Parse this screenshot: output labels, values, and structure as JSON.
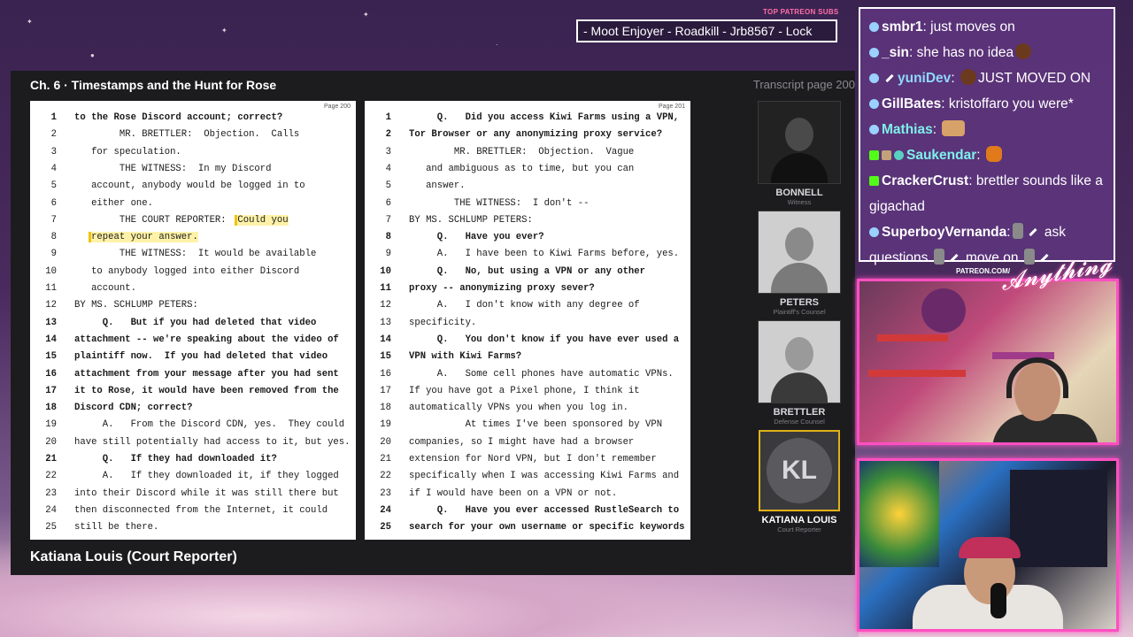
{
  "ticker": {
    "label": "TOP PATREON SUBS",
    "text": "- Moot Enjoyer - Roadkill - Jrb8567 - Lock"
  },
  "viewer": {
    "chapter": "Ch. 6  ·  Timestamps and the Hunt for Rose",
    "transcript_page": "Transcript page 200",
    "footer_speaker": "Katiana Louis (Court Reporter)",
    "pages": [
      {
        "page_label": "Page 200",
        "lines": [
          {
            "n": "1",
            "text": "to the Rose Discord account; correct?",
            "bold": true
          },
          {
            "n": "2",
            "text": "        MR. BRETTLER:  Objection.  Calls",
            "bold": false
          },
          {
            "n": "3",
            "text": "   for speculation.",
            "bold": false
          },
          {
            "n": "4",
            "text": "        THE WITNESS:  In my Discord",
            "bold": false
          },
          {
            "n": "5",
            "text": "   account, anybody would be logged in to",
            "bold": false
          },
          {
            "n": "6",
            "text": "   either one.",
            "bold": false
          },
          {
            "n": "7",
            "text": "        THE COURT REPORTER:  Could you",
            "bold": false
          },
          {
            "n": "8",
            "text": "   repeat your answer.",
            "bold": false
          },
          {
            "n": "9",
            "text": "        THE WITNESS:  It would be available",
            "bold": false
          },
          {
            "n": "10",
            "text": "   to anybody logged into either Discord",
            "bold": false
          },
          {
            "n": "11",
            "text": "   account.",
            "bold": false
          },
          {
            "n": "12",
            "text": "BY MS. SCHLUMP PETERS:",
            "bold": false
          },
          {
            "n": "13",
            "text": "     Q.   But if you had deleted that video",
            "bold": true
          },
          {
            "n": "14",
            "text": "attachment -- we're speaking about the video of",
            "bold": true
          },
          {
            "n": "15",
            "text": "plaintiff now.  If you had deleted that video",
            "bold": true
          },
          {
            "n": "16",
            "text": "attachment from your message after you had sent",
            "bold": true
          },
          {
            "n": "17",
            "text": "it to Rose, it would have been removed from the",
            "bold": true
          },
          {
            "n": "18",
            "text": "Discord CDN; correct?",
            "bold": true
          },
          {
            "n": "19",
            "text": "     A.   From the Discord CDN, yes.  They could",
            "bold": false
          },
          {
            "n": "20",
            "text": "have still potentially had access to it, but yes.",
            "bold": false
          },
          {
            "n": "21",
            "text": "     Q.   If they had downloaded it?",
            "bold": true
          },
          {
            "n": "22",
            "text": "     A.   If they downloaded it, if they logged",
            "bold": false
          },
          {
            "n": "23",
            "text": "into their Discord while it was still there but",
            "bold": false
          },
          {
            "n": "24",
            "text": "then disconnected from the Internet, it could",
            "bold": false
          },
          {
            "n": "25",
            "text": "still be there.",
            "bold": false
          }
        ],
        "highlight": [
          "Could you",
          "repeat your answer."
        ]
      },
      {
        "page_label": "Page 201",
        "lines": [
          {
            "n": "1",
            "text": "     Q.   Did you access Kiwi Farms using a VPN,",
            "bold": true
          },
          {
            "n": "2",
            "text": "Tor Browser or any anonymizing proxy service?",
            "bold": true
          },
          {
            "n": "3",
            "text": "        MR. BRETTLER:  Objection.  Vague",
            "bold": false
          },
          {
            "n": "4",
            "text": "   and ambiguous as to time, but you can",
            "bold": false
          },
          {
            "n": "5",
            "text": "   answer.",
            "bold": false
          },
          {
            "n": "6",
            "text": "        THE WITNESS:  I don't --",
            "bold": false
          },
          {
            "n": "7",
            "text": "BY MS. SCHLUMP PETERS:",
            "bold": false
          },
          {
            "n": "8",
            "text": "     Q.   Have you ever?",
            "bold": true
          },
          {
            "n": "9",
            "text": "     A.   I have been to Kiwi Farms before, yes.",
            "bold": false
          },
          {
            "n": "10",
            "text": "     Q.   No, but using a VPN or any other",
            "bold": true
          },
          {
            "n": "11",
            "text": "proxy -- anonymizing proxy sever?",
            "bold": true
          },
          {
            "n": "12",
            "text": "     A.   I don't know with any degree of",
            "bold": false
          },
          {
            "n": "13",
            "text": "specificity.",
            "bold": false
          },
          {
            "n": "14",
            "text": "     Q.   You don't know if you have ever used a",
            "bold": true
          },
          {
            "n": "15",
            "text": "VPN with Kiwi Farms?",
            "bold": true
          },
          {
            "n": "16",
            "text": "     A.   Some cell phones have automatic VPNs.",
            "bold": false
          },
          {
            "n": "17",
            "text": "If you have got a Pixel phone, I think it",
            "bold": false
          },
          {
            "n": "18",
            "text": "automatically VPNs you when you log in.",
            "bold": false
          },
          {
            "n": "19",
            "text": "          At times I've been sponsored by VPN",
            "bold": false
          },
          {
            "n": "20",
            "text": "companies, so I might have had a browser",
            "bold": false
          },
          {
            "n": "21",
            "text": "extension for Nord VPN, but I don't remember",
            "bold": false
          },
          {
            "n": "22",
            "text": "specifically when I was accessing Kiwi Farms and",
            "bold": false
          },
          {
            "n": "23",
            "text": "if I would have been on a VPN or not.",
            "bold": false
          },
          {
            "n": "24",
            "text": "     Q.   Have you ever accessed RustleSearch to",
            "bold": true
          },
          {
            "n": "25",
            "text": "search for your own username or specific keywords",
            "bold": true
          }
        ]
      }
    ],
    "participants": [
      {
        "name": "BONNELL",
        "role": "Witness",
        "initials": ""
      },
      {
        "name": "PETERS",
        "role": "Plaintiff's Counsel",
        "initials": ""
      },
      {
        "name": "BRETTLER",
        "role": "Defense Counsel",
        "initials": ""
      },
      {
        "name": "KATIANA LOUIS",
        "role": "Court Reporter",
        "initials": "KL"
      }
    ]
  },
  "chat": {
    "messages": [
      {
        "user": "smbr1",
        "text": "just moves on"
      },
      {
        "user": "_sin",
        "text": "she has no idea"
      },
      {
        "user": "yuniDev",
        "text": "JUST MOVED ON"
      },
      {
        "user": "GillBates",
        "text": "kristoffaro you were*"
      },
      {
        "user": "Mathias",
        "text": ""
      },
      {
        "user": "Saukendar",
        "text": ""
      },
      {
        "user": "CrackerCrust",
        "text": "brettler sounds like a gigachad"
      },
      {
        "user": "SuperboyVernanda",
        "text": "ask questions"
      },
      {
        "user": "",
        "text": "move on"
      }
    ]
  },
  "overlay": {
    "patreon_label": "PATREON.COM/",
    "brand_text": "AnythingElse"
  },
  "colors": {
    "accent_pink": "#ff4fc1",
    "highlight_yellow": "#fff2a8",
    "active_border": "#e0b21a",
    "chat_bg": "#5c347c"
  }
}
